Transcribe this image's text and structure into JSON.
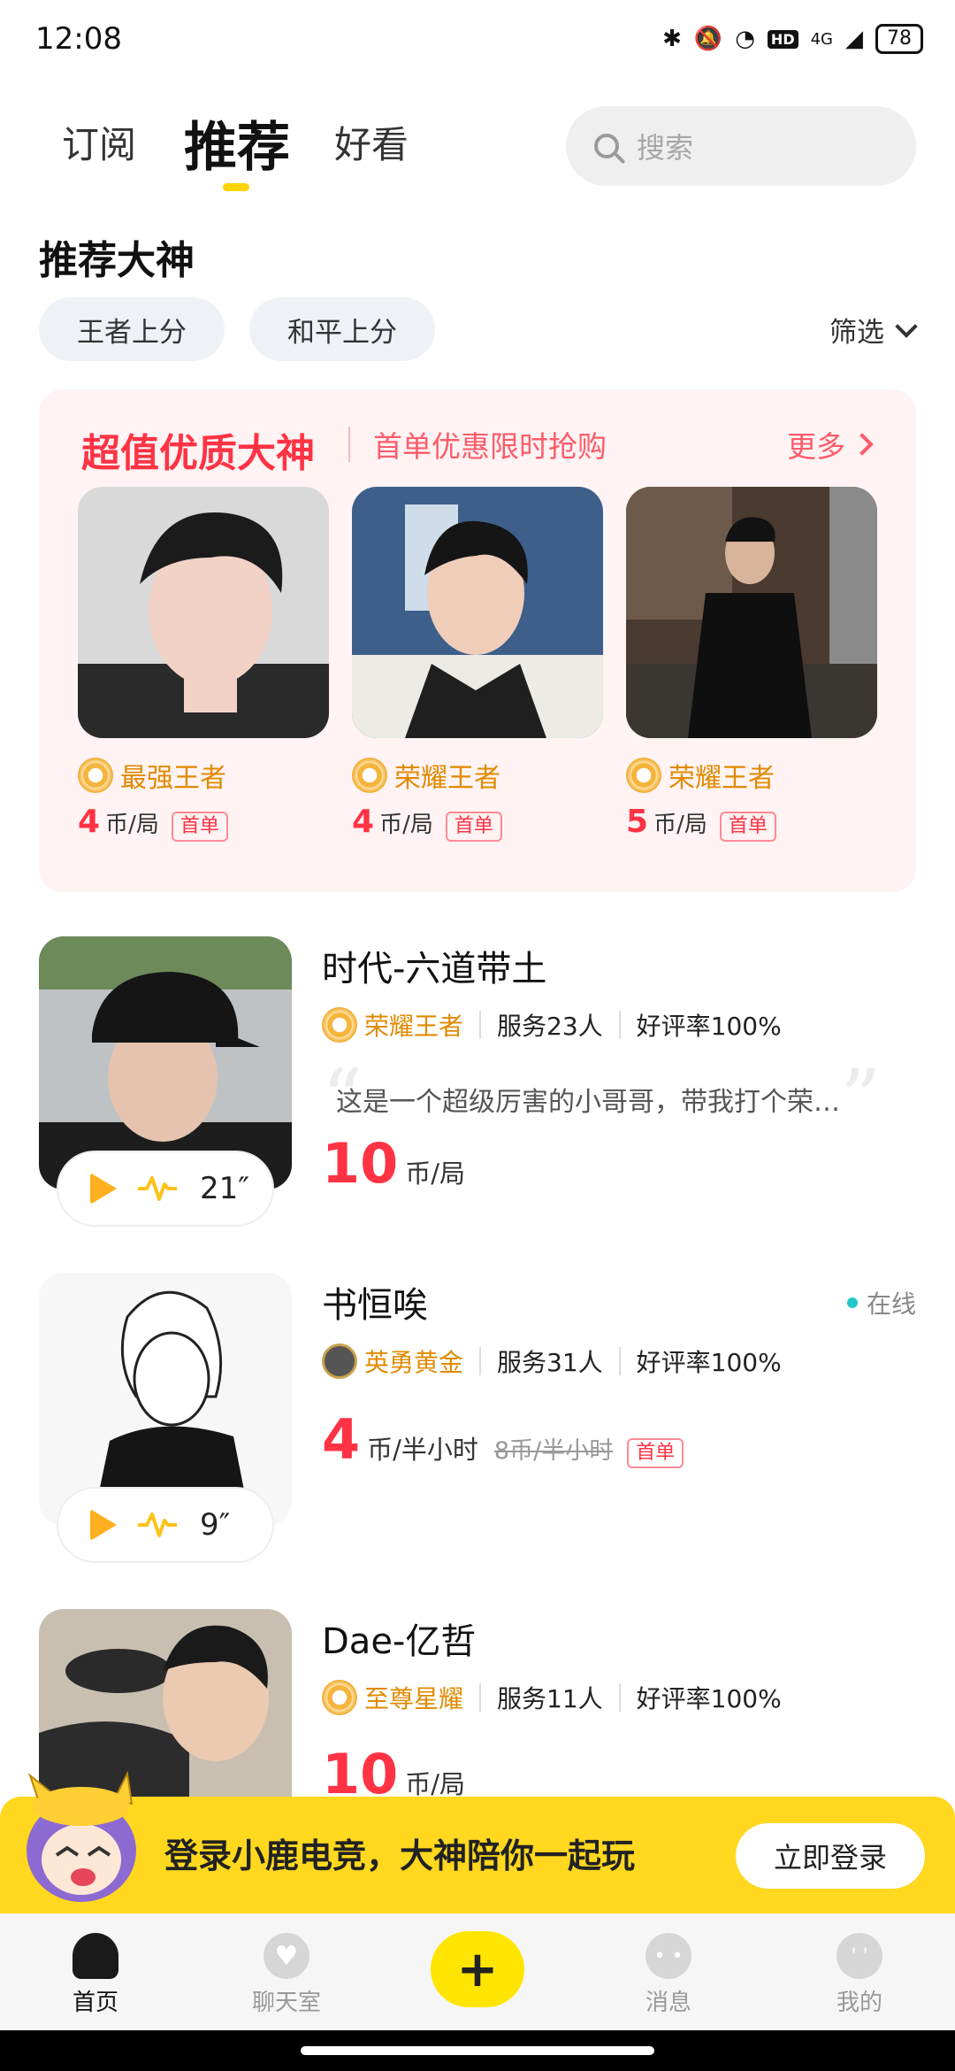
{
  "status_bar": {
    "time": "12:08",
    "network": "4G",
    "battery": "78",
    "hd": "HD"
  },
  "tabs": [
    {
      "label": "订阅"
    },
    {
      "label": "推荐"
    },
    {
      "label": "好看"
    }
  ],
  "search": {
    "placeholder": "搜索"
  },
  "section": {
    "title": "推荐大神",
    "chips": [
      "王者上分",
      "和平上分"
    ],
    "filter_label": "筛选"
  },
  "promo": {
    "title": "超值优质大神",
    "subtitle": "首单优惠限时抢购",
    "more": "更多",
    "cards": [
      {
        "rank": "最强王者",
        "price": "4",
        "unit": "币/局",
        "badge": "首单"
      },
      {
        "rank": "荣耀王者",
        "price": "4",
        "unit": "币/局",
        "badge": "首单"
      },
      {
        "rank": "荣耀王者",
        "price": "5",
        "unit": "币/局",
        "badge": "首单"
      }
    ]
  },
  "players": [
    {
      "name": "时代-六道带土",
      "rank": "荣耀王者",
      "served": "服务23人",
      "rating": "好评率100%",
      "quote": "这是一个超级厉害的小哥哥，带我打个荣…",
      "price": "10",
      "unit": "币/局",
      "voice": "21″"
    },
    {
      "name": "书恒唉",
      "status": "在线",
      "rank": "英勇黄金",
      "served": "服务31人",
      "rating": "好评率100%",
      "price": "4",
      "unit": "币/半小时",
      "old_price": "8币/半小时",
      "badge": "首单",
      "voice": "9″"
    },
    {
      "name": "Dae-亿哲",
      "rank": "至尊星耀",
      "served": "服务11人",
      "rating": "好评率100%",
      "price": "10",
      "unit": "币/局"
    }
  ],
  "banner": {
    "text": "登录小鹿电竞，大神陪你一起玩",
    "button": "立即登录"
  },
  "nav": {
    "home": "首页",
    "chat": "聊天室",
    "messages": "消息",
    "mine": "我的",
    "plus": "+"
  },
  "colors": {
    "accent": "#FFD400",
    "price_red": "#FF3344",
    "rank_gold": "#E08A00"
  }
}
